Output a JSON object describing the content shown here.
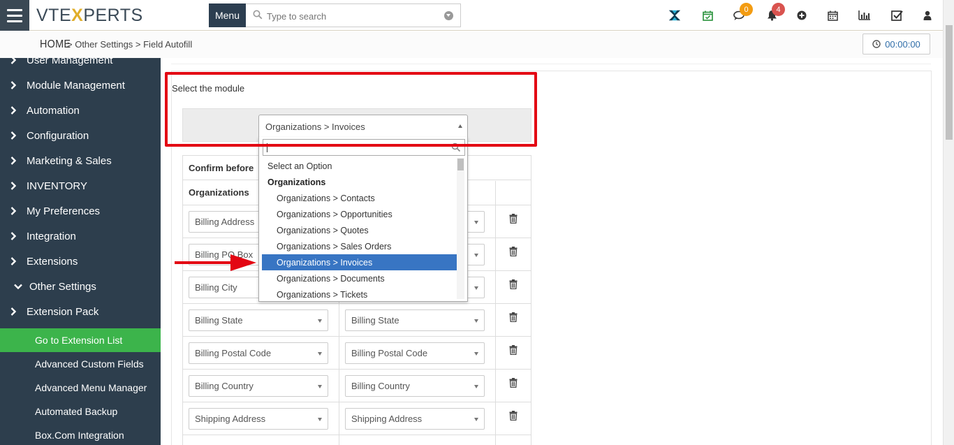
{
  "header": {
    "logo_prefix": "VTE",
    "logo_x": "X",
    "logo_suffix": "PERTS",
    "menu_label": "Menu",
    "search_placeholder": "Type to search",
    "chat_badge": "0",
    "notif_badge": "4"
  },
  "breadcrumb": {
    "home": "HOME",
    "path": "> Other Settings >  Field Autofill"
  },
  "timer": "00:00:00",
  "sidebar": {
    "partial_item": "User Management",
    "items": [
      {
        "label": "Module Management",
        "chevron": "right"
      },
      {
        "label": "Automation",
        "chevron": "right"
      },
      {
        "label": "Configuration",
        "chevron": "right"
      },
      {
        "label": "Marketing & Sales",
        "chevron": "right"
      },
      {
        "label": "INVENTORY",
        "chevron": "right"
      },
      {
        "label": "My Preferences",
        "chevron": "right"
      },
      {
        "label": "Integration",
        "chevron": "right"
      },
      {
        "label": "Extensions",
        "chevron": "right"
      },
      {
        "label": "Other Settings",
        "chevron": "down"
      },
      {
        "label": "Extension Pack",
        "chevron": "right"
      }
    ],
    "subitems": [
      {
        "label": "Go to Extension List",
        "active": true
      },
      {
        "label": "Advanced Custom Fields",
        "active": false
      },
      {
        "label": "Advanced Menu Manager",
        "active": false
      },
      {
        "label": "Automated Backup",
        "active": false
      },
      {
        "label": "Box.Com Integration",
        "active": false
      }
    ]
  },
  "main": {
    "select_label": "Select the module",
    "module_selected": "Organizations > Invoices",
    "confirm_text": "Confirm before",
    "column_header": "Organizations",
    "rows": [
      {
        "left": "Billing Address",
        "right": ""
      },
      {
        "left": "Billing PO Box",
        "right": ""
      },
      {
        "left": "Billing City",
        "right": ""
      },
      {
        "left": "Billing State",
        "right": "Billing State"
      },
      {
        "left": "Billing Postal Code",
        "right": "Billing Postal Code"
      },
      {
        "left": "Billing Country",
        "right": "Billing Country"
      },
      {
        "left": "Shipping Address",
        "right": "Shipping Address"
      }
    ]
  },
  "dropdown": {
    "search_value": "",
    "options": [
      {
        "label": "Select an Option",
        "type": "option",
        "highlighted": false
      },
      {
        "label": "Organizations",
        "type": "group",
        "highlighted": false
      },
      {
        "label": "Organizations > Contacts",
        "type": "child",
        "highlighted": false
      },
      {
        "label": "Organizations > Opportunities",
        "type": "child",
        "highlighted": false
      },
      {
        "label": "Organizations > Quotes",
        "type": "child",
        "highlighted": false
      },
      {
        "label": "Organizations > Sales Orders",
        "type": "child",
        "highlighted": false
      },
      {
        "label": "Organizations > Invoices",
        "type": "child",
        "highlighted": true
      },
      {
        "label": "Organizations > Documents",
        "type": "child",
        "highlighted": false
      },
      {
        "label": "Organizations > Tickets",
        "type": "child",
        "highlighted": false
      }
    ]
  },
  "colors": {
    "sidebar_bg": "#2d3e4d",
    "active_green": "#3cb44b",
    "highlight_blue": "#3875c3",
    "annotation_red": "#e30613",
    "badge_orange": "#f39c12",
    "badge_red": "#d9534f"
  }
}
